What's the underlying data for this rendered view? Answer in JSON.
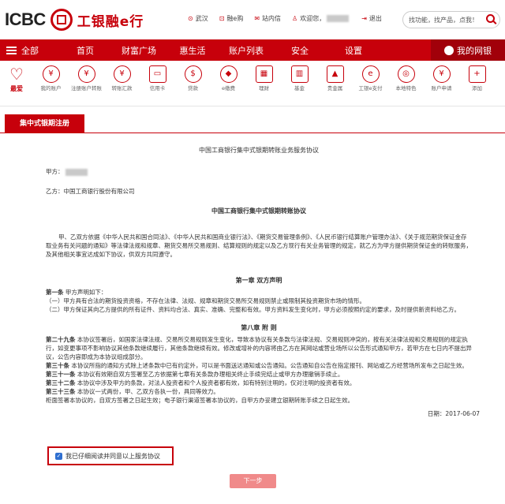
{
  "header": {
    "logo_text": "ICBC",
    "logo_cn": "工银融e行",
    "links": [
      {
        "icon": "location-icon",
        "glyph": "⊙",
        "label": "武汉"
      },
      {
        "icon": "cart-icon",
        "glyph": "⊡",
        "label": "融e购"
      },
      {
        "icon": "mail-icon",
        "glyph": "✉",
        "label": "站内信"
      },
      {
        "icon": "user-icon",
        "glyph": "♙",
        "label": "欢迎您，"
      },
      {
        "icon": "logout-icon",
        "glyph": "⇥",
        "label": "退出"
      }
    ],
    "search_placeholder": "找功能，找产品，点我！"
  },
  "nav": {
    "all_label": "全部",
    "items": [
      "首页",
      "财富广场",
      "惠生活",
      "账户列表",
      "安全",
      "设置"
    ],
    "mybank_label": "我的网银"
  },
  "shortcuts": [
    {
      "label": "最爱",
      "glyph": "♡",
      "name": "favorites-icon"
    },
    {
      "label": "我的账户",
      "glyph": "¥",
      "name": "account-icon"
    },
    {
      "label": "注册账户转账",
      "glyph": "¥",
      "name": "transfer-registered-icon"
    },
    {
      "label": "转账汇款",
      "glyph": "¥",
      "name": "transfer-icon"
    },
    {
      "label": "信用卡",
      "glyph": "▭",
      "name": "credit-card-icon"
    },
    {
      "label": "贷款",
      "glyph": "$",
      "name": "loan-icon"
    },
    {
      "label": "e缴费",
      "glyph": "◆",
      "name": "e-payment-icon"
    },
    {
      "label": "理财",
      "glyph": "▦",
      "name": "wealth-icon"
    },
    {
      "label": "基金",
      "glyph": "▥",
      "name": "fund-icon"
    },
    {
      "label": "贵金属",
      "glyph": "▲",
      "name": "precious-metal-icon"
    },
    {
      "label": "工银e支付",
      "glyph": "e",
      "name": "icbc-epay-icon"
    },
    {
      "label": "本地特色",
      "glyph": "◎",
      "name": "local-feature-icon"
    },
    {
      "label": "账户申请",
      "glyph": "¥",
      "name": "account-apply-icon"
    },
    {
      "label": "添加",
      "glyph": "+",
      "name": "add-icon"
    }
  ],
  "tab": {
    "label": "集中式银期注册"
  },
  "doc": {
    "title": "中国工商银行集中式银期转账业务服务协议",
    "party_a": "甲方：",
    "party_b": "乙方：中国工商银行股份有限公司",
    "subtitle": "中国工商银行集中式银期转账协议",
    "intro": "甲、乙双方依据《中华人民共和国合同法》、《中华人民共和国商业银行法》、《期货交易管理条例》、《人民币银行结算账户管理办法》、《关于规范期货保证金存取业务有关问题的通知》等法律法规和规章、期货交易所交易规则、结算规则的规定以及乙方现行有关业务管理的规定，就乙方为甲方提供期货保证金的转账服务，及其他相关事宜达成如下协议，供双方共同遵守。",
    "chapter1": "第一章 双方声明",
    "art1_head": "第一条",
    "art1_title": "甲方声明如下：",
    "art1_c1": "（一）甲方具有合法的期货投资资格，不存在法律、法规、规章和期货交易所交易规则禁止或限制其投资期货市场的情形。",
    "art1_c2": "（二）甲方保证其向乙方提供的所有证件、资料均合法、真实、准确、完整和有效。甲方资料发生变化时，甲方必须按照约定的要求，及时提供新资料给乙方。",
    "chapter8": "第八章 附 则",
    "art29_head": "第二十九条",
    "art29": "本协议签署后，如国家法律法规、交易所交易规则发生变化，导致本协议有关条款与法律法规、交易规则冲突的，按有关法律法规和交易规则的规定执行，如变更事项不影响协议其他条款继续履行，其他条款继续有效。修改或增补的内容将由乙方在其网站或营业场所以公告形式通知甲方，若甲方在七日内不提出异议，公告内容即成为本协议组成部分。",
    "art30_head": "第三十条",
    "art30": "本协议所指的通知方式除上述条款中已有约定外，可以是书面送达通知或公告通知。公告通知自公告在指定报刊、网站或乙方经营场所发布之日起生效。",
    "art31_head": "第三十一条",
    "art31": "本协议有效期自双方签署至乙方依据第七章有关条款办理相关终止手续完结止或甲方办理撤销手续止。",
    "art32_head": "第三十二条",
    "art32": "本协议中涉及甲方的条款，对法人投资者和个人投资者都有效，如有特别注明的，仅对注明的投资者有效。",
    "art33_head": "第三十三条",
    "art33": "本协议一式两份，甲、乙双方各执一份，具同等效力。",
    "closing": "柜面签署本协议的，自双方签署之日起生效；电子银行渠道签署本协议的，自甲方办妥建立银期转账手续之日起生效。",
    "date_label": "日期：",
    "date": "2017-06-07"
  },
  "agree_label": "我已仔细阅读并同意以上服务协议",
  "next_label": "下一步",
  "colors": {
    "brand_red": "#c7000b",
    "next_button": "#f08a8a"
  }
}
